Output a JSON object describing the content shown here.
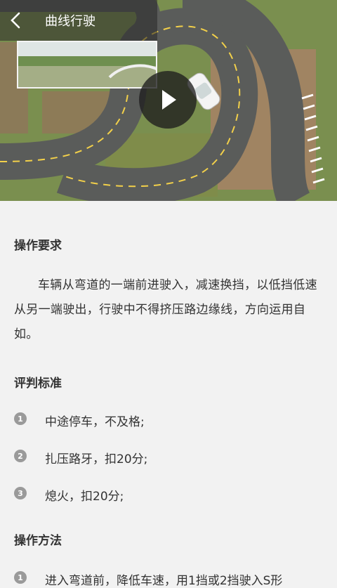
{
  "header": {
    "title": "曲线行驶",
    "back_icon": "chevron-left-icon"
  },
  "video": {
    "play_icon": "play-icon"
  },
  "sections": {
    "requirements": {
      "title": "操作要求",
      "text": "车辆从弯道的一端前进驶入，减速换挡，以低挡低速从另一端驶出，行驶中不得挤压路边缘线，方向运用自如。"
    },
    "scoring": {
      "title": "评判标准",
      "items": [
        {
          "num": "1",
          "text": "中途停车，不及格;"
        },
        {
          "num": "2",
          "text": "扎压路牙，扣20分;"
        },
        {
          "num": "3",
          "text": "熄火，扣20分;"
        }
      ]
    },
    "method": {
      "title": "操作方法",
      "items": [
        {
          "num": "1",
          "text": "进入弯道前，降低车速，用1挡或2挡驶入S形"
        }
      ]
    }
  }
}
